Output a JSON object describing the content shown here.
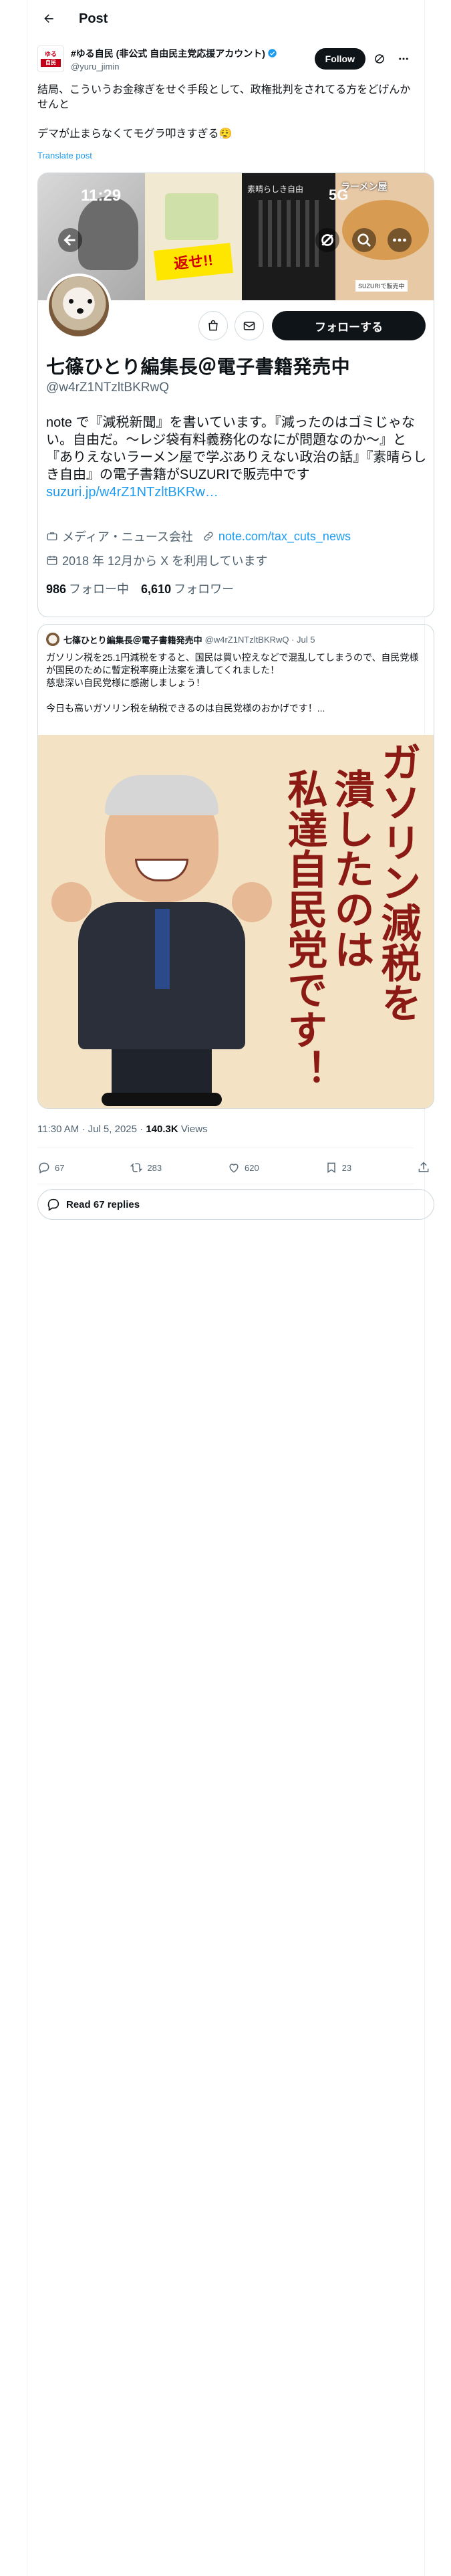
{
  "header": {
    "title": "Post"
  },
  "author": {
    "avatar_top": "ゆる",
    "avatar_bottom": "自民",
    "name": "#ゆる自民 (非公式 自由民主党応援アカウント)",
    "handle": "@yuru_jimin",
    "follow_label": "Follow"
  },
  "post": {
    "text": "結局、こういうお金稼ぎをせぐ手段として、政権批判をされてる方をどげんかせんと\n\nデマが止まらなくてモグラ叩きすぎる😮‍💨",
    "translate_label": "Translate post"
  },
  "profile_card": {
    "status_time": "11:29",
    "status_right": "5G",
    "banner_sticker": "返せ!!",
    "banner_caption": "素晴らしき自由",
    "banner_tag": "SUZURIで販売中",
    "banner_text4": "ラーメン屋",
    "name": "七篠ひとり編集長＠電子書籍発売中",
    "handle": "@w4rZ1NTzltBKRwQ",
    "follow_label": "フォローする",
    "bio": "note で『減税新聞』を書いています。『減ったのはゴミじゃない。自由だ。〜レジ袋有料義務化のなにが問題なのか〜』と『ありえないラーメン屋で学ぶありえない政治の話』『素晴らしき自由』の電子書籍がSUZURIで販売中です",
    "bio_link": "suzuri.jp/w4rZ1NTzltBKRw…",
    "category": "メディア・ニュース会社",
    "website": "note.com/tax_cuts_news",
    "joined": "2018 年 12月から X を利用しています",
    "following_count": "986",
    "following_label": "フォロー中",
    "followers_count": "6,610",
    "followers_label": "フォロワー"
  },
  "quote": {
    "name": "七篠ひとり編集長＠電子書籍発売中",
    "handle": "@w4rZ1NTzltBKRwQ · Jul 5",
    "text": "ガソリン税を25.1円減税をすると、国民は買い控えなどで混乱してしまうので、自民党様が国民のために暫定税率廃止法案を潰してくれました！\n慈悲深い自民党様に感謝しましょう！\n\n今日も高いガソリン税を納税できるのは自民党様のおかげです！...",
    "image_text_col1": "ガソリン減税を",
    "image_text_col2": "潰したのは",
    "image_text_col3": "私達自民党です！"
  },
  "meta": {
    "time": "11:30 AM · Jul 5, 2025 · ",
    "views_count": "140.3K",
    "views_label": " Views"
  },
  "actions": {
    "replies": "67",
    "reposts": "283",
    "likes": "620",
    "bookmarks": "23"
  },
  "read_replies_label": "Read 67 replies"
}
